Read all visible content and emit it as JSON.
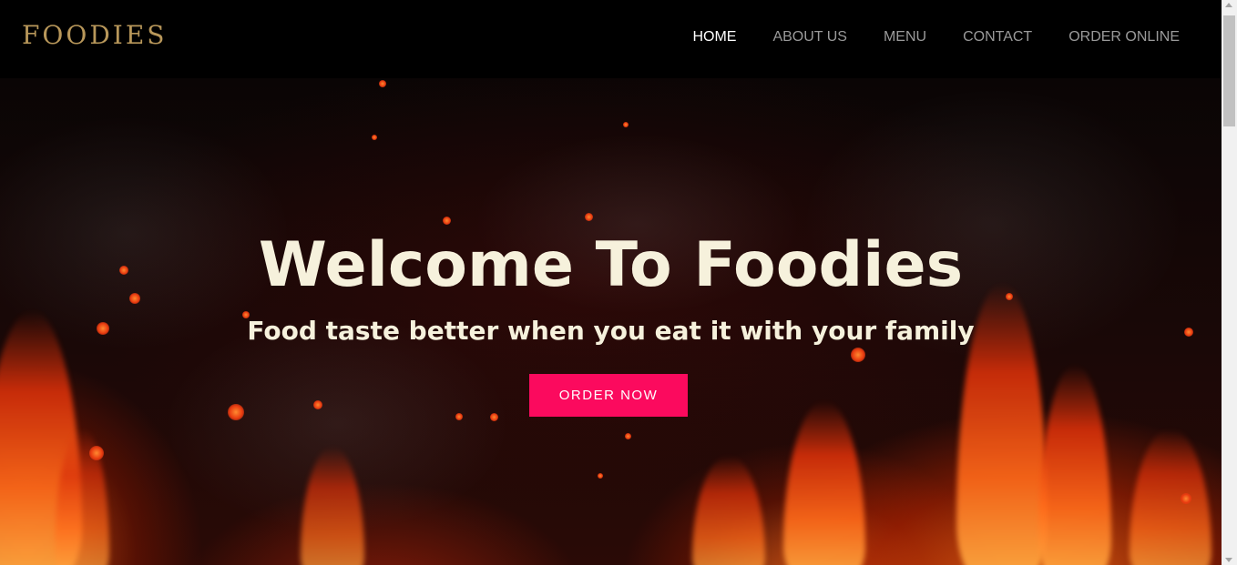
{
  "brand": {
    "logo_text": "FOODIES",
    "logo_color": "#b8975a"
  },
  "nav": {
    "items": [
      {
        "label": "HOME",
        "active": true
      },
      {
        "label": "ABOUT US",
        "active": false
      },
      {
        "label": "MENU",
        "active": false
      },
      {
        "label": "CONTACT",
        "active": false
      },
      {
        "label": "ORDER ONLINE",
        "active": false
      }
    ],
    "active_color": "#ffffff",
    "inactive_color": "#9a9a9a"
  },
  "hero": {
    "title": "Welcome To Foodies",
    "subtitle": "Food taste better when you eat it with your family",
    "cta_label": "ORDER NOW",
    "cta_color": "#fb0a5e",
    "text_color": "#f6f1dc",
    "background": "fire-embers-image"
  },
  "icons": {
    "scroll_up": "chevron-up-icon",
    "scroll_down": "chevron-down-icon"
  }
}
